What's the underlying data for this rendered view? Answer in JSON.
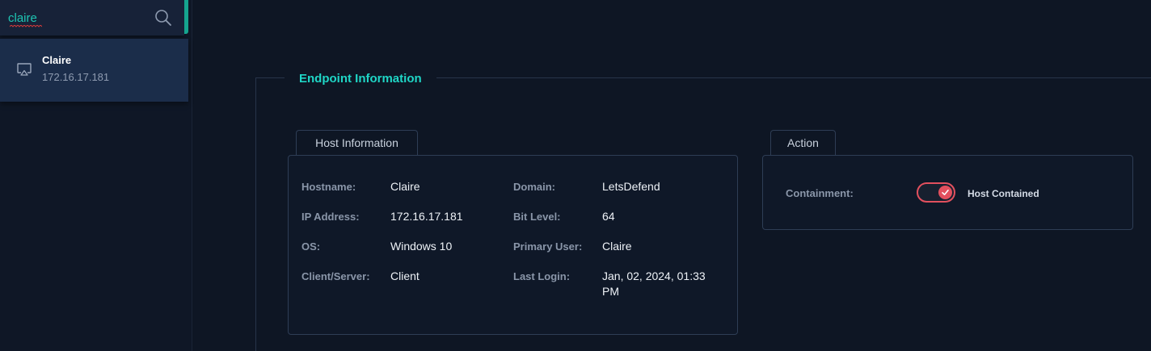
{
  "search": {
    "value": "claire"
  },
  "results": [
    {
      "name": "Claire",
      "ip": "172.16.17.181"
    }
  ],
  "main": {
    "title": "Endpoint Information"
  },
  "host_info": {
    "tab": "Host Information",
    "left": [
      {
        "key": "Hostname:",
        "value": "Claire"
      },
      {
        "key": "IP Address:",
        "value": "172.16.17.181"
      },
      {
        "key": "OS:",
        "value": "Windows 10"
      },
      {
        "key": "Client/Server:",
        "value": "Client"
      }
    ],
    "right": [
      {
        "key": "Domain:",
        "value": "LetsDefend"
      },
      {
        "key": "Bit Level:",
        "value": "64"
      },
      {
        "key": "Primary User:",
        "value": "Claire"
      },
      {
        "key": "Last Login:",
        "value": "Jan, 02, 2024, 01:33 PM"
      }
    ]
  },
  "action": {
    "tab": "Action",
    "containment_label": "Containment:",
    "status": "Host Contained",
    "contained": true
  },
  "colors": {
    "accent_teal": "#1fd6c6",
    "toggle_red": "#e2505e",
    "background": "#0e1624"
  }
}
